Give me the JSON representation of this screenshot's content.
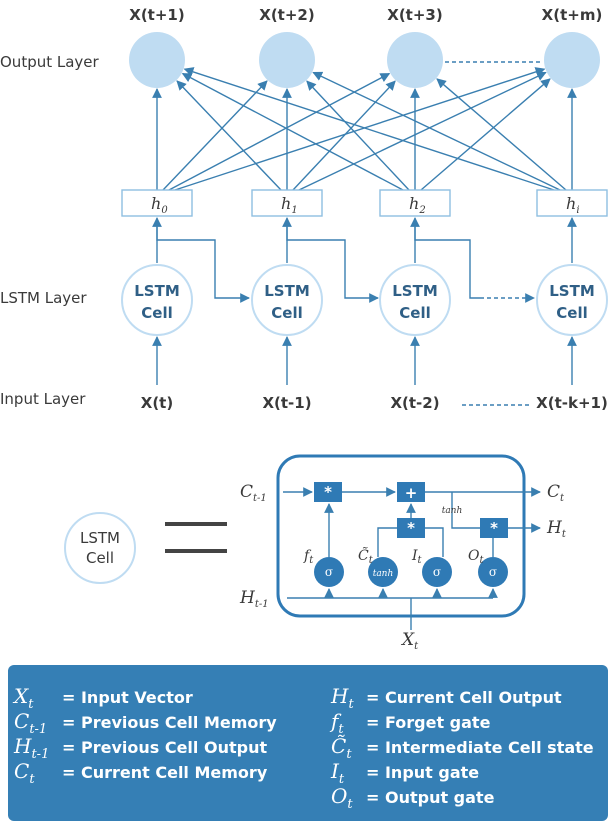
{
  "colors": {
    "node_fill": "#bfdcf2",
    "line": "#3a7fb0",
    "box": "#2f7ab5",
    "legend_bg": "#357fb5"
  },
  "layers": {
    "output": "Output Layer",
    "lstm": "LSTM Layer",
    "input": "Input Layer"
  },
  "outputs": [
    "X(t+1)",
    "X(t+2)",
    "X(t+3)",
    "X(t+m)"
  ],
  "hidden": [
    {
      "base": "h",
      "sub": "0"
    },
    {
      "base": "h",
      "sub": "1"
    },
    {
      "base": "h",
      "sub": "2"
    },
    {
      "base": "h",
      "sub": "i"
    }
  ],
  "cells": [
    {
      "line1": "LSTM",
      "line2": "Cell"
    },
    {
      "line1": "LSTM",
      "line2": "Cell"
    },
    {
      "line1": "LSTM",
      "line2": "Cell"
    },
    {
      "line1": "LSTM",
      "line2": "Cell"
    }
  ],
  "inputs": [
    "X(t)",
    "X(t-1)",
    "X(t-2)",
    "X(t-k+1)"
  ],
  "detail": {
    "cell_line1": "LSTM",
    "cell_line2": "Cell",
    "c_prev": {
      "base": "C",
      "sub": "t-1"
    },
    "h_prev": {
      "base": "H",
      "sub": "t-1"
    },
    "c_out": {
      "base": "C",
      "sub": "t"
    },
    "h_out": {
      "base": "H",
      "sub": "t"
    },
    "x_in": {
      "base": "X",
      "sub": "t"
    },
    "mult": "*",
    "plus": "+",
    "tanh_label": "tanh",
    "gates": [
      {
        "label": {
          "base": "f",
          "sub": "t"
        },
        "fn": "σ"
      },
      {
        "label": {
          "base": "C̃",
          "sub": "t"
        },
        "fn": "tanh"
      },
      {
        "label": {
          "base": "I",
          "sub": "t"
        },
        "fn": "σ"
      },
      {
        "label": {
          "base": "O",
          "sub": "t"
        },
        "fn": "σ"
      }
    ]
  },
  "legend": {
    "left": [
      {
        "base": "X",
        "sub": "t",
        "text": "= Input Vector"
      },
      {
        "base": "C",
        "sub": "t-1",
        "text": "= Previous Cell Memory"
      },
      {
        "base": "H",
        "sub": "t-1",
        "text": "= Previous Cell Output"
      },
      {
        "base": "C",
        "sub": "t",
        "text": "= Current Cell Memory"
      }
    ],
    "right": [
      {
        "base": "H",
        "sub": "t",
        "text": "= Current Cell Output"
      },
      {
        "base": "f",
        "sub": "t",
        "text": "= Forget gate"
      },
      {
        "base": "C̃",
        "sub": "t",
        "text": "= Intermediate Cell state"
      },
      {
        "base": "I",
        "sub": "t",
        "text": "= Input gate"
      },
      {
        "base": "O",
        "sub": "t",
        "text": "= Output gate"
      }
    ]
  }
}
